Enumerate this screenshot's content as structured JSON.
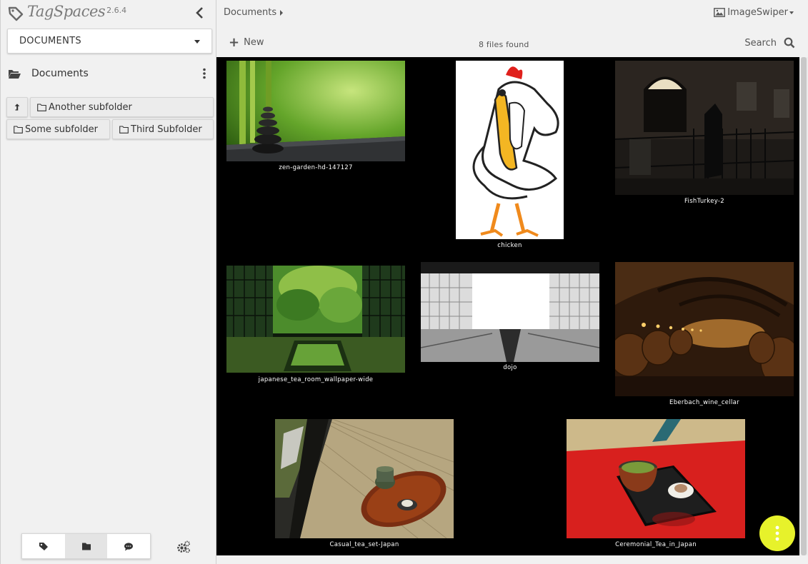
{
  "app": {
    "name": "TagSpaces",
    "version": "2.6.4"
  },
  "sidebar": {
    "location": "DOCUMENTS",
    "current_dir": "Documents",
    "subfolders": [
      "Another subfolder",
      "Some subfolder",
      "Third Subfolder"
    ],
    "bottom_tabs": [
      "tags-icon",
      "folder-icon",
      "chat-icon"
    ]
  },
  "main": {
    "breadcrumb": "Documents",
    "perspective": "ImageSwiper",
    "new_label": "New",
    "files_found": "8 files found",
    "search_label": "Search",
    "files": [
      {
        "name": "zen-garden-hd-147127"
      },
      {
        "name": "chicken"
      },
      {
        "name": "FishTurkey-2"
      },
      {
        "name": "japanese_tea_room_wallpaper-wide"
      },
      {
        "name": "dojo"
      },
      {
        "name": "Eberbach_wine_cellar"
      },
      {
        "name": "Casual_tea_set-Japan"
      },
      {
        "name": "Ceremonial_Tea_in_Japan"
      }
    ]
  },
  "colors": {
    "fab": "#e7f22b",
    "grid_bg": "#000000",
    "sidebar_bg": "#f1f1f1"
  }
}
